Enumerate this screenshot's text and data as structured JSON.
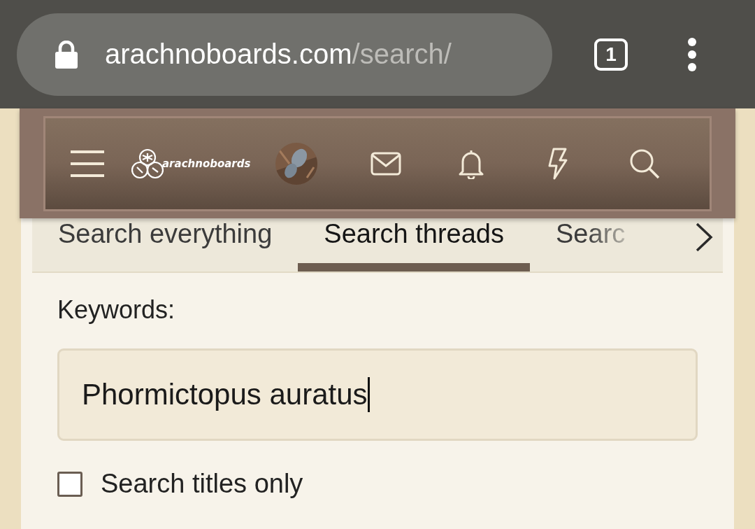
{
  "browser": {
    "url_host": "arachnoboards.com",
    "url_path": "/search/",
    "tab_count": "1"
  },
  "header": {
    "logo_text": "arachnoboards"
  },
  "tabs": [
    {
      "label": "Search everything",
      "selected": false
    },
    {
      "label": "Search threads",
      "selected": true
    },
    {
      "label": "Searc",
      "selected": false
    }
  ],
  "keywords": {
    "label": "Keywords:",
    "value": "Phormictopus auratus"
  },
  "titles_only": {
    "label": "Search titles only",
    "checked": false
  }
}
